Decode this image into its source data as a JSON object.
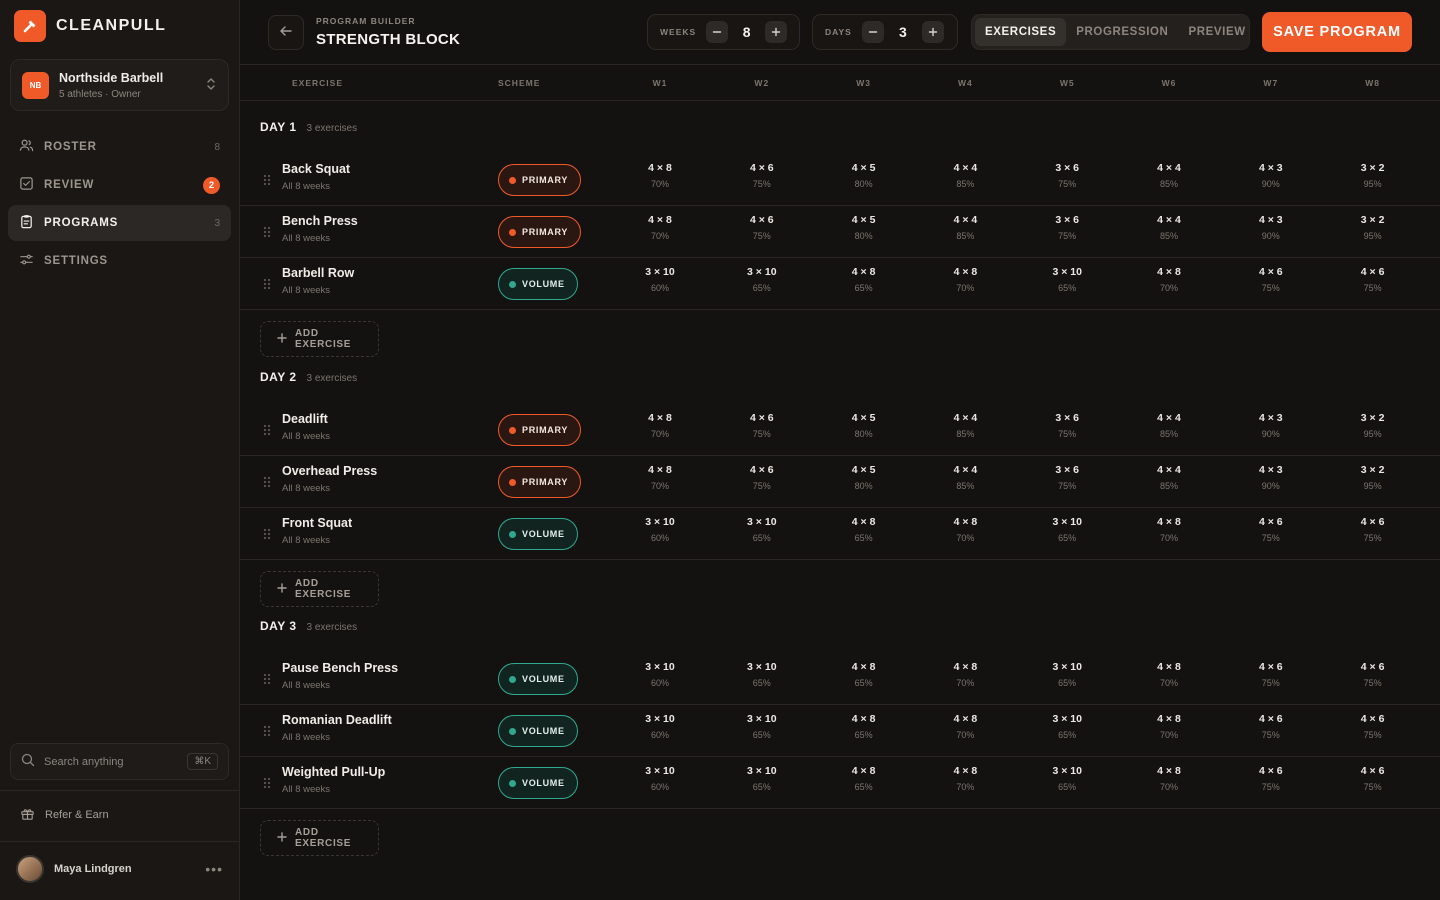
{
  "app": {
    "name": "CLEANPULL",
    "accent": "#f05a28",
    "volume_color": "#2fa88f"
  },
  "team": {
    "initials": "NB",
    "name": "Northside Barbell",
    "sub": "5 athletes · Owner"
  },
  "nav": [
    {
      "label": "ROSTER",
      "icon": "users-icon",
      "count": "8",
      "active": false
    },
    {
      "label": "REVIEW",
      "icon": "checkbox-icon",
      "badge": "2",
      "active": false
    },
    {
      "label": "PROGRAMS",
      "icon": "clipboard-icon",
      "count": "3",
      "active": true
    },
    {
      "label": "SETTINGS",
      "icon": "sliders-icon",
      "count": "",
      "active": false
    }
  ],
  "search": {
    "placeholder": "Search anything",
    "shortcut": "⌘K"
  },
  "refer": {
    "label": "Refer & Earn"
  },
  "user": {
    "name": "Maya Lindgren"
  },
  "header": {
    "breadcrumb": "PROGRAM BUILDER",
    "title": "STRENGTH BLOCK",
    "weeks_label": "WEEKS",
    "weeks_value": "8",
    "days_label": "DAYS",
    "days_value": "3",
    "tabs": [
      "EXERCISES",
      "PROGRESSION",
      "PREVIEW"
    ],
    "active_tab": "EXERCISES",
    "save_label": "SAVE PROGRAM"
  },
  "columns": {
    "exercise": "EXERCISE",
    "scheme": "SCHEME",
    "weeks": [
      "W1",
      "W2",
      "W3",
      "W4",
      "W5",
      "W6",
      "W7",
      "W8"
    ]
  },
  "add_label": "ADD EXERCISE",
  "schemes": {
    "primary": {
      "label": "PRIMARY",
      "cells": [
        [
          "4 × 8",
          "70%"
        ],
        [
          "4 × 6",
          "75%"
        ],
        [
          "4 × 5",
          "80%"
        ],
        [
          "4 × 4",
          "85%"
        ],
        [
          "3 × 6",
          "75%"
        ],
        [
          "4 × 4",
          "85%"
        ],
        [
          "4 × 3",
          "90%"
        ],
        [
          "3 × 2",
          "95%"
        ]
      ]
    },
    "volume": {
      "label": "VOLUME",
      "cells": [
        [
          "3 × 10",
          "60%"
        ],
        [
          "3 × 10",
          "65%"
        ],
        [
          "4 × 8",
          "65%"
        ],
        [
          "4 × 8",
          "70%"
        ],
        [
          "3 × 10",
          "65%"
        ],
        [
          "4 × 8",
          "70%"
        ],
        [
          "4 × 6",
          "75%"
        ],
        [
          "4 × 6",
          "75%"
        ]
      ]
    }
  },
  "days": [
    {
      "title": "DAY 1",
      "count": "3 exercises",
      "exercises": [
        {
          "name": "Back Squat",
          "sub": "All 8 weeks",
          "scheme": "primary"
        },
        {
          "name": "Bench Press",
          "sub": "All 8 weeks",
          "scheme": "primary"
        },
        {
          "name": "Barbell Row",
          "sub": "All 8 weeks",
          "scheme": "volume"
        }
      ]
    },
    {
      "title": "DAY 2",
      "count": "3 exercises",
      "exercises": [
        {
          "name": "Deadlift",
          "sub": "All 8 weeks",
          "scheme": "primary"
        },
        {
          "name": "Overhead Press",
          "sub": "All 8 weeks",
          "scheme": "primary"
        },
        {
          "name": "Front Squat",
          "sub": "All 8 weeks",
          "scheme": "volume"
        }
      ]
    },
    {
      "title": "DAY 3",
      "count": "3 exercises",
      "exercises": [
        {
          "name": "Pause Bench Press",
          "sub": "All 8 weeks",
          "scheme": "volume"
        },
        {
          "name": "Romanian Deadlift",
          "sub": "All 8 weeks",
          "scheme": "volume"
        },
        {
          "name": "Weighted Pull-Up",
          "sub": "All 8 weeks",
          "scheme": "volume"
        }
      ]
    }
  ]
}
